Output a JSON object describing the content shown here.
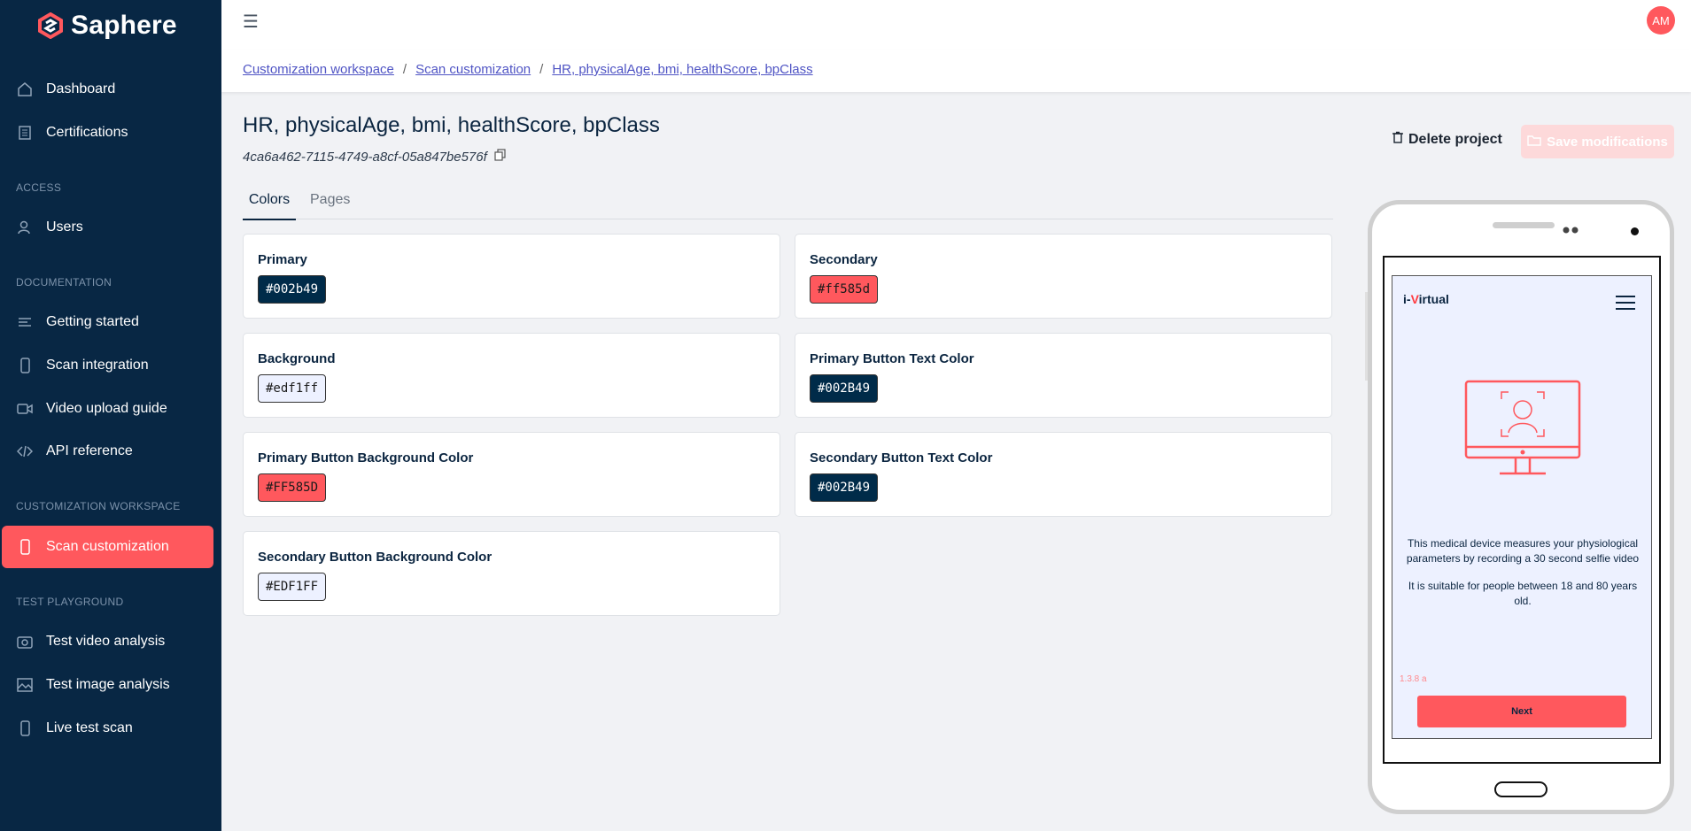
{
  "sidebar": {
    "brand": "Saphere",
    "items": [
      {
        "label": "Dashboard"
      },
      {
        "label": "Certifications"
      },
      {
        "label": "Users"
      },
      {
        "label": "Getting started"
      },
      {
        "label": "Scan integration"
      },
      {
        "label": "Video upload guide"
      },
      {
        "label": "API reference"
      },
      {
        "label": "Scan customization"
      },
      {
        "label": "Test video analysis"
      },
      {
        "label": "Test image analysis"
      },
      {
        "label": "Live test scan"
      }
    ],
    "sections": {
      "access": "ACCESS",
      "documentation": "DOCUMENTATION",
      "customization": "CUSTOMIZATION WORKSPACE",
      "playground": "TEST PLAYGROUND"
    },
    "active_color": "#ff585d",
    "bg_color": "#082744"
  },
  "header": {
    "avatar": "AM"
  },
  "breadcrumb": {
    "items": [
      "Customization workspace",
      "Scan customization",
      "HR, physicalAge, bmi, healthScore, bpClass"
    ],
    "separator": "/"
  },
  "project": {
    "title": "HR, physicalAge, bmi, healthScore, bpClass",
    "uuid": "4ca6a462-7115-4749-a8cf-05a847be576f",
    "delete_label": "Delete project",
    "save_label": "Save modifications"
  },
  "tabs": [
    "Colors",
    "Pages"
  ],
  "colors": [
    {
      "label": "Primary",
      "value": "#002b49",
      "bg": "#002b49",
      "fg": "#ffffff"
    },
    {
      "label": "Secondary",
      "value": "#ff585d",
      "bg": "#ff585d",
      "fg": "#1b1b1b"
    },
    {
      "label": "Background",
      "value": "#edf1ff",
      "bg": "#edf1ff",
      "fg": "#1b1b1b"
    },
    {
      "label": "Primary Button Text Color",
      "value": "#002B49",
      "bg": "#002b49",
      "fg": "#ffffff"
    },
    {
      "label": "Primary Button Background Color",
      "value": "#FF585D",
      "bg": "#ff585d",
      "fg": "#1b1b1b"
    },
    {
      "label": "Secondary Button Text Color",
      "value": "#002B49",
      "bg": "#002b49",
      "fg": "#ffffff"
    },
    {
      "label": "Secondary Button Background Color",
      "value": "#EDF1FF",
      "bg": "#edf1ff",
      "fg": "#1b1b1b"
    }
  ],
  "preview": {
    "brand_prefix": "i-",
    "brand_v": "V",
    "brand_suffix": "irtual",
    "message1": "This medical device measures your physiological parameters by recording a 30 second selfie video",
    "message2": "It is suitable for people between 18 and 80 years old.",
    "version": "1.3.8 a",
    "next_label": "Next"
  }
}
